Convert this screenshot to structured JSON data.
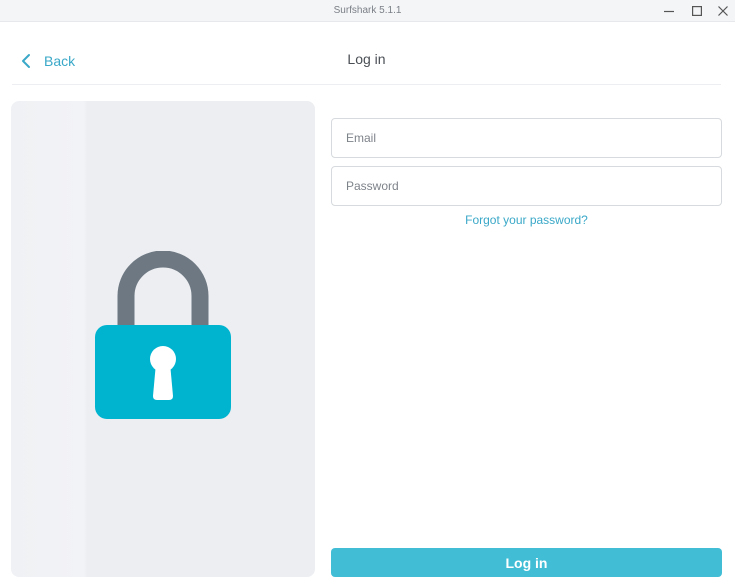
{
  "window": {
    "title": "Surfshark 5.1.1"
  },
  "header": {
    "back_label": "Back",
    "title": "Log in"
  },
  "form": {
    "email_placeholder": "Email",
    "email_value": "",
    "password_placeholder": "Password",
    "password_value": "",
    "forgot_label": "Forgot your password?",
    "submit_label": "Log in"
  },
  "icons": {
    "back": "chevron-left-icon",
    "minimize": "minimize-icon",
    "maximize": "maximize-icon",
    "close": "close-icon",
    "illustration": "padlock-icon"
  },
  "colors": {
    "accent": "#42bdd6",
    "link": "#3aa8c8",
    "lock_body": "#00b4d0",
    "lock_shackle": "#6e7882",
    "panel_bg": "#eceef2"
  }
}
